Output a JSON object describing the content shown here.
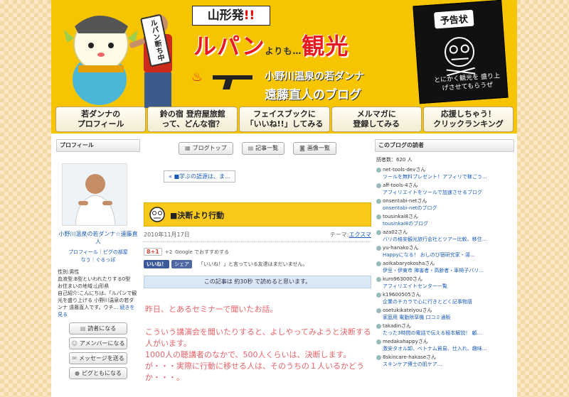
{
  "header": {
    "vert_label": "ルパン断ち中",
    "yamagata": "山形発",
    "yamagata_mark": "!!",
    "title_a": "ルパン",
    "title_small": "よりも…",
    "title_b": "観光",
    "sub1": "小野川温泉の若ダンナ",
    "sub2": "遠藤直人のブログ",
    "notice_title": "予告状",
    "notice_text": "とにかく観光を\n盛り上げさせてもらうぜ"
  },
  "nav": [
    {
      "label": "若ダンナの\nプロフィール"
    },
    {
      "label": "鈴の宿 登府屋旅館\nって、どんな宿？"
    },
    {
      "label": "フェイスブックに\n「いいね!!」してみる"
    },
    {
      "label": "メルマガに\n登録してみる"
    },
    {
      "label": "応援しちゃう！\nクリックランキング"
    }
  ],
  "left": {
    "heading": "プロフィール",
    "name": "小野川温泉の若ダンナ☆遠藤直人",
    "links": "プロフィール｜ピグの部屋\nなう｜ぐるっぽ",
    "info": "性別:男性\n血液型:B型といわれたりする0型\nお住まいの地域:山形県\n自己紹介:こんにちは、「ルパンで観光を盛り上げる 小野川温泉の若ダンナ 遠藤直人です。ウチ...",
    "more": "続きを見る",
    "buttons": [
      "読者になる",
      "アメンバーになる",
      "メッセージを送る",
      "ピグともになる"
    ]
  },
  "center": {
    "tabs": [
      "ブログトップ",
      "記事一覧",
      "画像一覧"
    ],
    "prev_link": "« ■学ぶの語源は、ま…",
    "post_title": "■決断より行動",
    "date": "2010年11月17日",
    "theme_label": "テーマ:",
    "theme": "エクスマ",
    "gplus_btn": "8+1",
    "gplus_count": "+2",
    "gplus_text": "Google でおすすめする",
    "fb_like": "いいね！",
    "fb_share": "シェア",
    "fb_text": "「いいね！」と言っている友達はまだいません。",
    "readtime": "この記事は 約30秒 で読めると思います。",
    "body": "昨日、とあるセミナーで聞いたお話。\n\nこういう講演会を聞いたりすると、よしやってみようと決断する人がいます。\n1000人の聴講者のなかで、500人くらいは、決断します。\nが・・・実際に行動に移せる人は、そのうちの１人いるかどうか・・・。"
  },
  "right": {
    "heading": "このブログの読者",
    "count": "読者数：620 人",
    "readers": [
      {
        "user": "net-tools-devさん",
        "title": "ツールを無料プレゼント！アフィリで稼ごう…"
      },
      {
        "user": "aff-tools-4さん",
        "title": "アフィリエイトをツールで加速させるブログ"
      },
      {
        "user": "onsentabi-netさん",
        "title": "onsentabi-netのブログ"
      },
      {
        "user": "tousinkai8さん",
        "title": "tousinkai8のブログ"
      },
      {
        "user": "aza02さん",
        "title": "バリの格安観光旅行会社とツアー比較、移住…"
      },
      {
        "user": "yu-hanakoさん",
        "title": "Happyになる！ おしのび宿研究家・湯…"
      },
      {
        "user": "aoikabaryokoshaさん",
        "title": "伊豆・伊東市 陣害者・高齢者・車椅子バリ…"
      },
      {
        "user": "kuro963000さん",
        "title": "アフィリエイトセンター一覧"
      },
      {
        "user": "k19600505さん",
        "title": "企業のチカラで心に行きとどく記事物語"
      },
      {
        "user": "osetukikateiyouさん",
        "title": "家庭用 電動除草機 口コミ通販"
      },
      {
        "user": "takadinさん",
        "title": "たった3時間の電話で伝える極本解説！ 顧…"
      },
      {
        "user": "medakahappyさん",
        "title": "激安タオル卸、ベトナム貿易、仕入れ、趣味…"
      },
      {
        "user": "8skincare-hakaseさん",
        "title": "スキンケア博士の肌ケア…"
      }
    ]
  }
}
